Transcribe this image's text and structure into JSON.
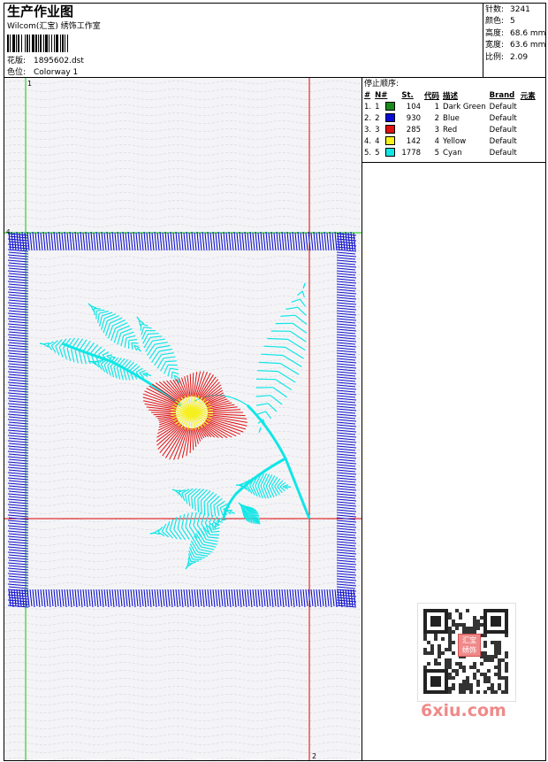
{
  "header": {
    "title": "生产作业图",
    "studio": "Wilcom(汇宝) 绣饰工作室",
    "design_label": "花版:",
    "design_file": "1895602.dst",
    "colorway_label": "色位:",
    "colorway": "Colorway 1"
  },
  "stats": {
    "stitches_label": "针数:",
    "stitches": "3241",
    "colors_label": "颜色:",
    "colors": "5",
    "height_label": "高度:",
    "height": "68.6 mm",
    "width_label": "宽度:",
    "width": "63.6 mm",
    "scale_label": "比例:",
    "scale": "2.09"
  },
  "stop_sequence": {
    "heading": "停止顺序:",
    "columns": [
      "#",
      "N#",
      "St.",
      "代码",
      "描述",
      "Brand",
      "元素"
    ],
    "rows": [
      {
        "idx": "1.",
        "n": "1",
        "color": "#1a8a1a",
        "st": "104",
        "code": "1",
        "desc": "Dark Green",
        "brand": "Default"
      },
      {
        "idx": "2.",
        "n": "2",
        "color": "#0a0ad8",
        "st": "930",
        "code": "2",
        "desc": "Blue",
        "brand": "Default"
      },
      {
        "idx": "3.",
        "n": "3",
        "color": "#e01010",
        "st": "285",
        "code": "3",
        "desc": "Red",
        "brand": "Default"
      },
      {
        "idx": "4.",
        "n": "4",
        "color": "#f6f020",
        "st": "142",
        "code": "4",
        "desc": "Yellow",
        "brand": "Default"
      },
      {
        "idx": "5.",
        "n": "5",
        "color": "#10e6e6",
        "st": "1778",
        "code": "5",
        "desc": "Cyan",
        "brand": "Default"
      }
    ]
  },
  "markers": {
    "guide_1": "1",
    "guide_2": "2",
    "guide_4": "4"
  },
  "watermark": {
    "text": "6xiu.com",
    "stamp": "汇宝绣饰"
  },
  "colors": {
    "frame_blue": "#1010cc",
    "guide_green": "#00cc00",
    "guide_red": "#dd0000",
    "petal_red": "#e01010",
    "center_yellow": "#f6f020",
    "leaf_cyan": "#10e6e6",
    "watermark_pink": "#f08a8a"
  }
}
